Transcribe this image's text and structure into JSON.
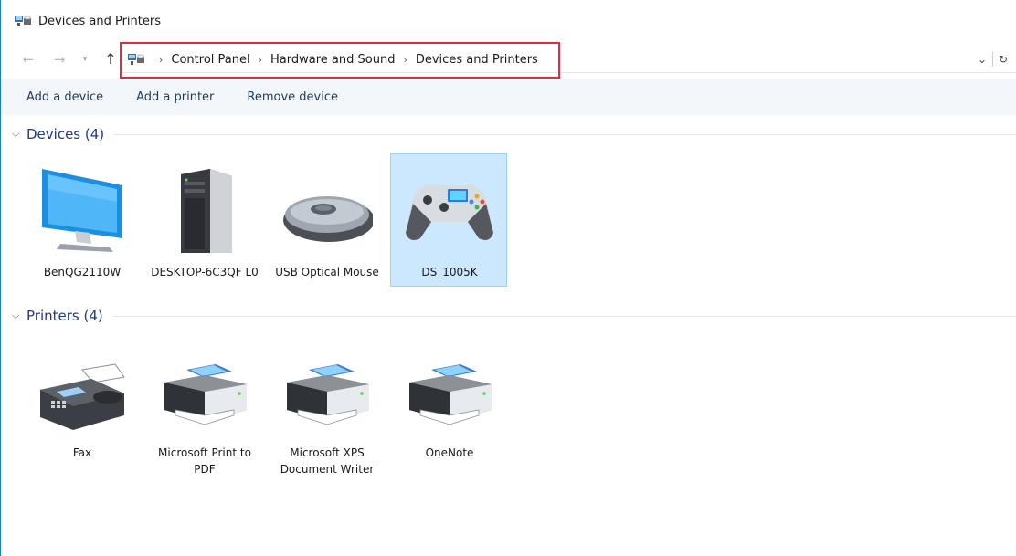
{
  "window": {
    "title": "Devices and Printers",
    "accent": "#1f7bd0"
  },
  "address": {
    "crumbs": [
      "Control Panel",
      "Hardware and Sound",
      "Devices and Printers"
    ],
    "highlight_color": "#e02c3c",
    "icons": {
      "dropdown": "chevron-down-icon",
      "refresh": "refresh-icon"
    }
  },
  "commands": {
    "add_device": "Add a device",
    "add_printer": "Add a printer",
    "remove_device": "Remove device"
  },
  "groups": {
    "devices": {
      "label": "Devices (4)",
      "items": [
        {
          "name": "BenQG2110W",
          "icon": "monitor-icon",
          "selected": false
        },
        {
          "name": "DESKTOP-6C3QF L0",
          "icon": "computer-tower-icon",
          "selected": false
        },
        {
          "name": "USB Optical Mouse",
          "icon": "mouse-icon",
          "selected": false
        },
        {
          "name": "DS_1005K",
          "icon": "gamepad-icon",
          "selected": true
        }
      ]
    },
    "printers": {
      "label": "Printers (4)",
      "items": [
        {
          "name": "Fax",
          "icon": "fax-icon"
        },
        {
          "name": "Microsoft Print to PDF",
          "icon": "printer-icon"
        },
        {
          "name": "Microsoft XPS Document Writer",
          "icon": "printer-icon"
        },
        {
          "name": "OneNote",
          "icon": "printer-icon"
        }
      ]
    }
  },
  "colors": {
    "selection_bg": "#cce8ff",
    "selection_border": "#99d1ff",
    "group_label": "#1e3a8a",
    "command_bar_bg": "#f3f6fb"
  }
}
